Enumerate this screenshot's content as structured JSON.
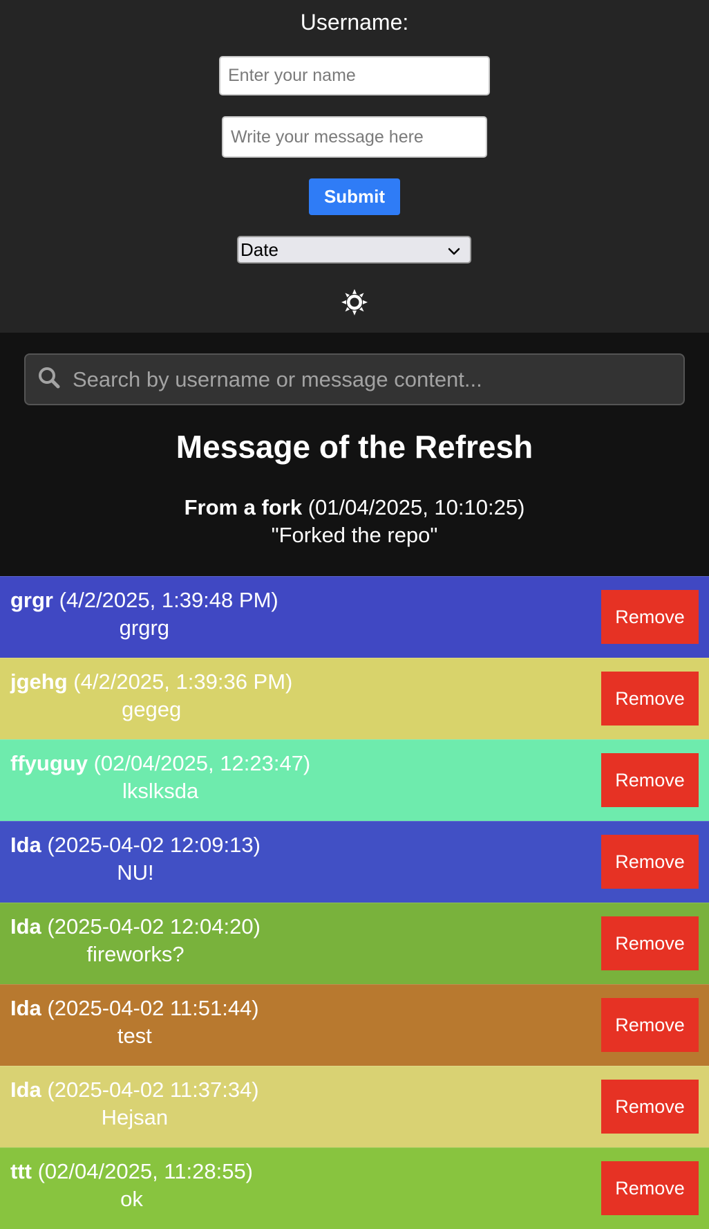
{
  "form": {
    "title": "Username:",
    "name_placeholder": "Enter your name",
    "message_placeholder": "Write your message here",
    "submit_label": "Submit",
    "sort_value": "Date",
    "theme_icon": "sun-icon"
  },
  "search": {
    "placeholder": "Search by username or message content...",
    "icon": "search-icon"
  },
  "featured": {
    "heading": "Message of the Refresh",
    "username": "From a fork",
    "timestamp": "(01/04/2025, 10:10:25)",
    "text": "\"Forked the repo\""
  },
  "messages": [
    {
      "username": "grgr",
      "timestamp": "(4/2/2025, 1:39:48 PM)",
      "text": "grgrg",
      "color": "#4048c3",
      "remove_label": "Remove"
    },
    {
      "username": "jgehg",
      "timestamp": "(4/2/2025, 1:39:36 PM)",
      "text": "gegeg",
      "color": "#d8d36b",
      "remove_label": "Remove"
    },
    {
      "username": "ffyuguy",
      "timestamp": "(02/04/2025, 12:23:47)",
      "text": "lkslksda",
      "color": "#6eebad",
      "remove_label": "Remove"
    },
    {
      "username": "Ida",
      "timestamp": "(2025-04-02 12:09:13)",
      "text": "NU!",
      "color": "#4150c5",
      "remove_label": "Remove"
    },
    {
      "username": "Ida",
      "timestamp": "(2025-04-02 12:04:20)",
      "text": "fireworks?",
      "color": "#79b23c",
      "remove_label": "Remove"
    },
    {
      "username": "Ida",
      "timestamp": "(2025-04-02 11:51:44)",
      "text": "test",
      "color": "#b8792f",
      "remove_label": "Remove"
    },
    {
      "username": "Ida",
      "timestamp": "(2025-04-02 11:37:34)",
      "text": "Hejsan",
      "color": "#d9d273",
      "remove_label": "Remove"
    },
    {
      "username": "ttt",
      "timestamp": "(02/04/2025, 11:28:55)",
      "text": "ok",
      "color": "#88c43f",
      "remove_label": "Remove"
    }
  ]
}
